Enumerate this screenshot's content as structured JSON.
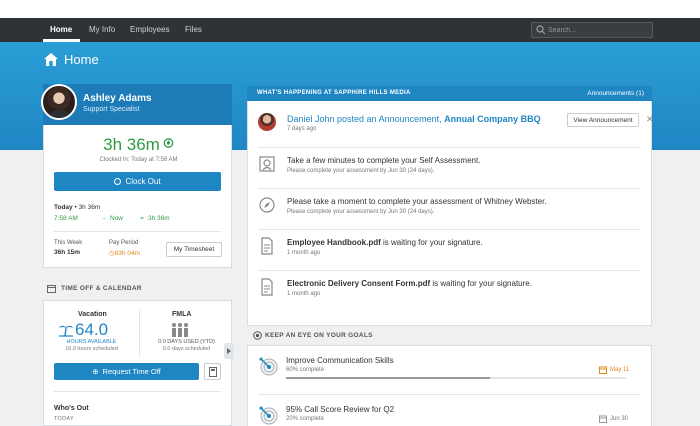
{
  "nav": {
    "items": [
      {
        "label": "Home",
        "active": true
      },
      {
        "label": "My Info",
        "active": false
      },
      {
        "label": "Employees",
        "active": false
      },
      {
        "label": "Files",
        "active": false
      }
    ],
    "search_placeholder": "Search..."
  },
  "page": {
    "title": "Home",
    "icon": "home-icon"
  },
  "profile": {
    "name": "Ashley Adams",
    "title": "Support Specialist",
    "timer": "3h 36m",
    "clocked_in": "Clocked In: Today at 7:58 AM",
    "clock_out_label": "Clock Out",
    "today_label": "Today",
    "today_total": "3h 36m",
    "start": "7:58 AM",
    "now": "Now",
    "duration": "3h 36m",
    "this_week_label": "This Week",
    "this_week_value": "36h 15m",
    "pay_period_label": "Pay Period",
    "pay_period_value": "83h 04m",
    "timesheet_label": "My Timesheet"
  },
  "time_off": {
    "section_title": "TIME OFF & CALENDAR",
    "vacation_label": "Vacation",
    "vacation_value": "64.0",
    "hours_available": "HOURS AVAILABLE",
    "vacation_scheduled": "16.0 hours scheduled",
    "fmla_label": "FMLA",
    "fmla_used": "0.0 DAYS USED (YTD)",
    "fmla_scheduled": "0.0 days scheduled",
    "request_label": "Request Time Off",
    "whos_out_label": "Who's Out",
    "today_label": "TODAY"
  },
  "announcements": {
    "header_title": "WHAT'S HAPPENING AT SAPPHIRE HILLS MEDIA",
    "header_count": "Announcements (1)",
    "items": [
      {
        "author": "Daniel John",
        "action": " posted an Announcement, ",
        "subject": "Annual Company BBQ",
        "sub": "7 days ago",
        "button": "View Announcement",
        "icon": "user-avatar-icon"
      },
      {
        "main": "Take a few minutes to complete your Self Assessment.",
        "sub": "Please complete your assessment by Jun 30 (24 days).",
        "icon": "assessment-icon"
      },
      {
        "main": "Please take a moment to complete your assessment of Whitney Webster.",
        "sub": "Please complete your assessment by Jun 30 (24 days).",
        "icon": "compass-icon"
      },
      {
        "doc": "Employee Handbook.pdf",
        "rest": " is waiting for your signature.",
        "sub": "1 month ago",
        "icon": "document-icon"
      },
      {
        "doc": "Electronic Delivery Consent Form.pdf",
        "rest": " is waiting for your signature.",
        "sub": "1 month ago",
        "icon": "document-icon"
      }
    ]
  },
  "goals": {
    "section_title": "KEEP AN EYE ON YOUR GOALS",
    "items": [
      {
        "name": "Improve Communication Skills",
        "pct_label": "60% complete",
        "pct": 0.6,
        "date": "May 11",
        "overdue": true
      },
      {
        "name": "95% Call Score Review for Q2",
        "pct_label": "20% complete",
        "pct": 0.2,
        "date": "Jun 30",
        "overdue": false
      }
    ]
  },
  "colors": {
    "accent": "#1f86c4",
    "nav_bg": "#2f3336",
    "green": "#2e9b44",
    "orange": "#e08a1c"
  }
}
